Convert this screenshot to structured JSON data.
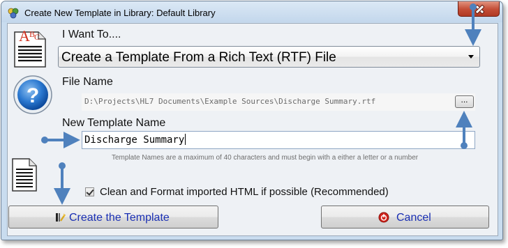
{
  "window": {
    "title": "Create New Template in Library: Default Library"
  },
  "form": {
    "want_label": "I Want To....",
    "want_selected": "Create a Template From a Rich Text (RTF) File",
    "file_label": "File Name",
    "file_value": "D:\\Projects\\HL7 Documents\\Example Sources\\Discharge Summary.rtf",
    "browse_label": "...",
    "template_name_label": "New Template Name",
    "template_name_value": "Discharge Summary",
    "hint": "Template Names are a maximum of 40 characters and must begin with a either a letter or a number",
    "clean_label": "Clean and Format imported HTML if possible (Recommended)",
    "clean_checked": true
  },
  "buttons": {
    "create_label": "Create the Template",
    "cancel_label": "Cancel"
  },
  "icons": {
    "title": "app-icon",
    "abc": "abc-document-icon",
    "help": "help-icon",
    "doc": "document-icon",
    "create": "template-wand-icon",
    "cancel": "cancel-icon",
    "close": "close-icon",
    "combo_arrow": "chevron-down-icon"
  },
  "colors": {
    "annotation_arrow": "#4f81bd",
    "button_text": "#1a2fb3",
    "close_button": "#c44e37"
  }
}
